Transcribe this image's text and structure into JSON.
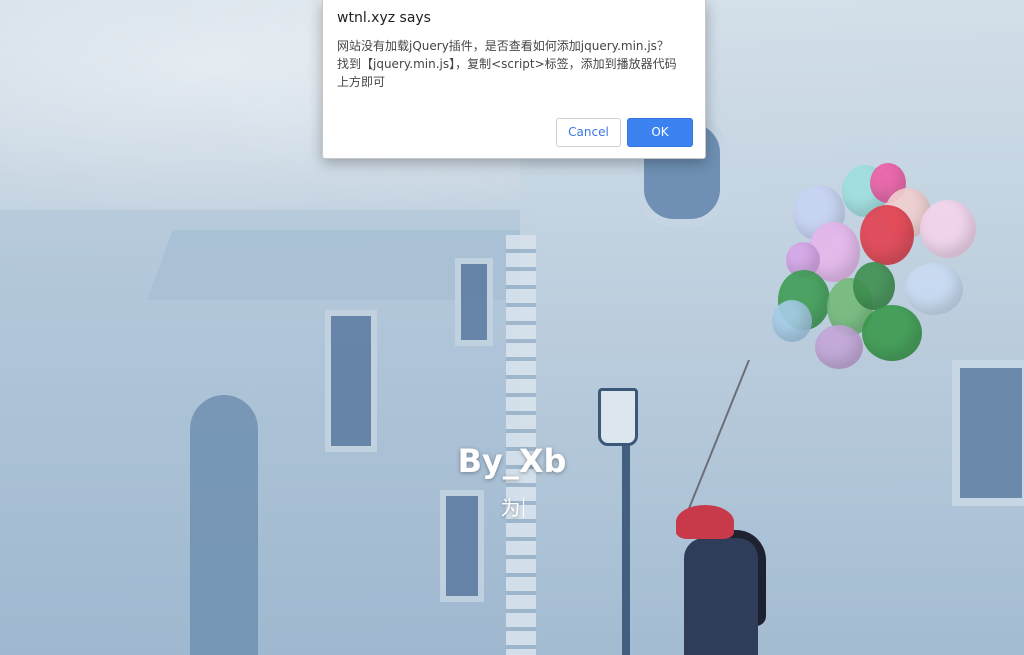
{
  "dialog": {
    "title": "wtnl.xyz says",
    "message": "网站没有加载jQuery插件，是否查看如何添加jquery.min.js？\n找到【jquery.min.js】，复制<script>标签，添加到播放器代码\n上方即可",
    "cancel_label": "Cancel",
    "ok_label": "OK"
  },
  "page": {
    "title": "By_Xb",
    "typing_text": "为"
  },
  "colors": {
    "ok_button": "#3b82f0",
    "cancel_text": "#3b78e7",
    "background": "#a9c0d6"
  }
}
